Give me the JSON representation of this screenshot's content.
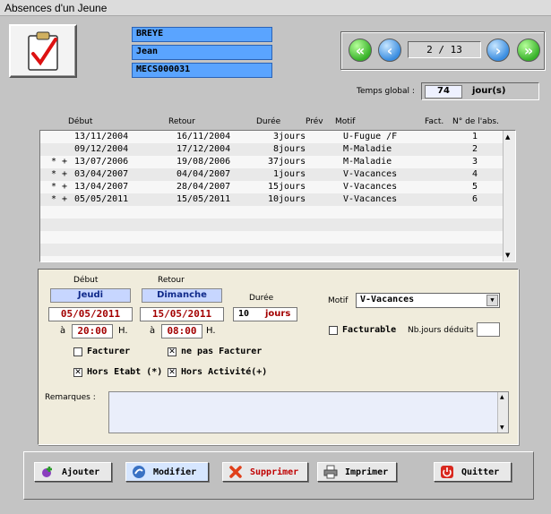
{
  "window": {
    "title": "Absences d'un Jeune"
  },
  "youth": {
    "lastname": "BREYE",
    "firstname": "Jean",
    "code": "MECS000031"
  },
  "nav": {
    "page": "2 / 13"
  },
  "temps_global": {
    "label": "Temps global :",
    "value": "74",
    "unit": "jour(s)"
  },
  "columns": {
    "debut": "Début",
    "retour": "Retour",
    "duree": "Durée",
    "prev": "Prév",
    "motif": "Motif",
    "fact": "Fact.",
    "num": "N° de l'abs."
  },
  "rows": [
    {
      "marks": "",
      "debut": "13/11/2004",
      "retour": "16/11/2004",
      "duree": "3jours",
      "motif": "U-Fugue /F",
      "num": "1"
    },
    {
      "marks": "",
      "debut": "09/12/2004",
      "retour": "17/12/2004",
      "duree": "8jours",
      "motif": "M-Maladie",
      "num": "2"
    },
    {
      "marks": "* +",
      "debut": "13/07/2006",
      "retour": "19/08/2006",
      "duree": "37jours",
      "motif": "M-Maladie",
      "num": "3"
    },
    {
      "marks": "* +",
      "debut": "03/04/2007",
      "retour": "04/04/2007",
      "duree": "1jours",
      "motif": "V-Vacances",
      "num": "4"
    },
    {
      "marks": "* +",
      "debut": "13/04/2007",
      "retour": "28/04/2007",
      "duree": "15jours",
      "motif": "V-Vacances",
      "num": "5"
    },
    {
      "marks": "* +",
      "debut": "05/05/2011",
      "retour": "15/05/2011",
      "duree": "10jours",
      "motif": "V-Vacances",
      "num": "6"
    }
  ],
  "detail": {
    "debut_label": "Début",
    "retour_label": "Retour",
    "duree_label": "Durée",
    "debut_day": "Jeudi",
    "retour_day": "Dimanche",
    "debut_date": "05/05/2011",
    "retour_date": "15/05/2011",
    "a_label": "à",
    "h_label": "H.",
    "debut_time": "20:00",
    "retour_time": "08:00",
    "duree_value": "10",
    "duree_unit": "jours",
    "motif_label": "Motif",
    "motif_value": "V-Vacances",
    "facturable_label": "Facturable",
    "nbjours_label": "Nb.jours déduits",
    "nbjours_value": "",
    "facturer_label": "Facturer",
    "ne_pas_facturer_label": "ne pas Facturer",
    "hors_etabt_label": "Hors Etabt (*)",
    "hors_activite_label": "Hors Activité(+)",
    "remarques_label": "Remarques :",
    "remarques_value": "",
    "checkboxes": {
      "facturable": false,
      "facturer": false,
      "ne_pas_facturer": true,
      "hors_etabt": true,
      "hors_activite": true
    }
  },
  "buttons": {
    "ajouter": "Ajouter",
    "modifier": "Modifier",
    "supprimer": "Supprimer",
    "imprimer": "Imprimer",
    "quitter": "Quitter"
  },
  "colors": {
    "id_field": "#5aa4ff",
    "date_red": "#a30000",
    "panel": "#f0ecdc",
    "accent_blue": "#3a8de0"
  }
}
